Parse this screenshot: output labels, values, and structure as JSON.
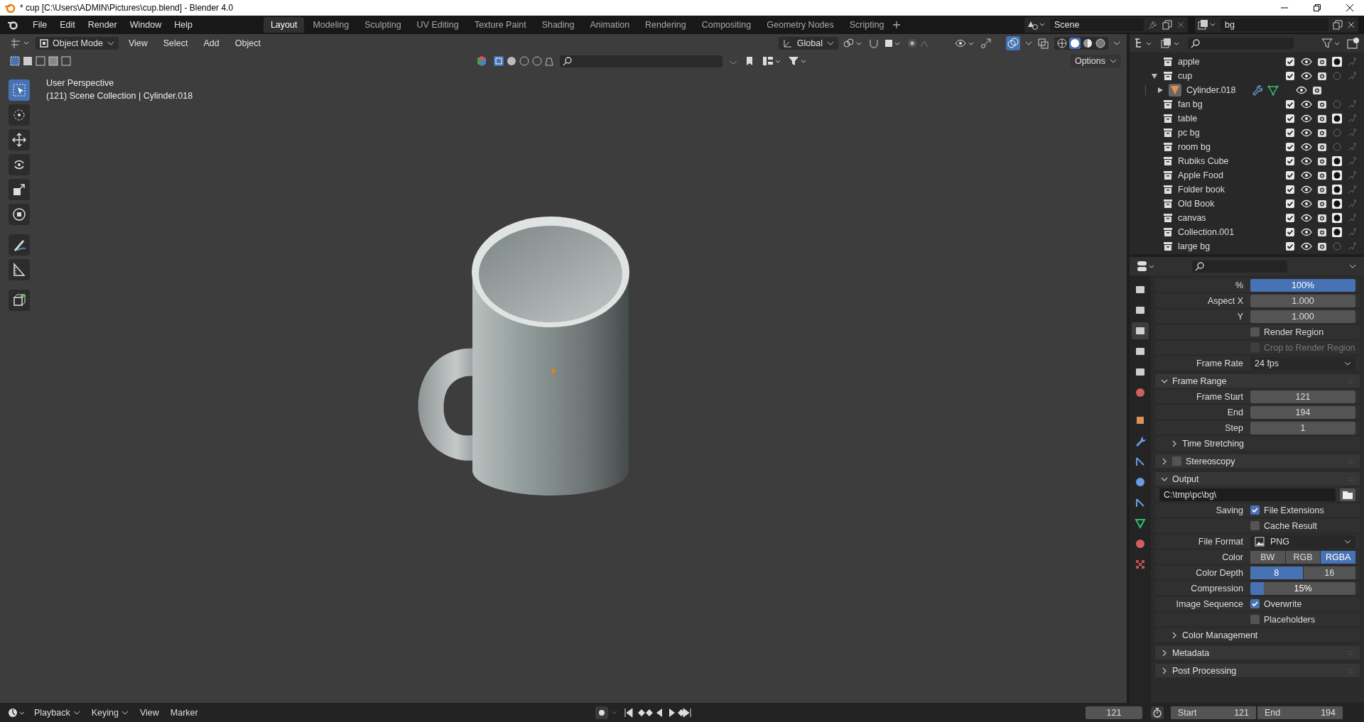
{
  "window": {
    "title": "* cup [C:\\Users\\ADMIN\\Pictures\\cup.blend] - Blender 4.0"
  },
  "menu": [
    "File",
    "Edit",
    "Render",
    "Window",
    "Help"
  ],
  "workspaces": [
    {
      "label": "Layout",
      "selected": true
    },
    {
      "label": "Modeling",
      "selected": false
    },
    {
      "label": "Sculpting",
      "selected": false
    },
    {
      "label": "UV Editing",
      "selected": false
    },
    {
      "label": "Texture Paint",
      "selected": false
    },
    {
      "label": "Shading",
      "selected": false
    },
    {
      "label": "Animation",
      "selected": false
    },
    {
      "label": "Rendering",
      "selected": false
    },
    {
      "label": "Compositing",
      "selected": false
    },
    {
      "label": "Geometry Nodes",
      "selected": false
    },
    {
      "label": "Scripting",
      "selected": false
    }
  ],
  "scene": "Scene",
  "view_layer": "bg",
  "viewport": {
    "mode": "Object Mode",
    "menus": [
      "View",
      "Select",
      "Add",
      "Object"
    ],
    "orientation": "Global",
    "options": "Options",
    "overlay": [
      "User Perspective",
      "(121) Scene Collection | Cylinder.018"
    ],
    "tools": [
      {
        "selected": true
      },
      {
        "selected": false
      },
      {
        "selected": false
      },
      {
        "selected": false
      },
      {
        "selected": false
      },
      {
        "selected": false
      },
      {
        "selected": false
      },
      {
        "selected": false
      },
      {
        "selected": false
      }
    ]
  },
  "outliner": [
    {
      "name": "apple",
      "kind": "collection",
      "checked": true,
      "holdout": true
    },
    {
      "name": "cup",
      "kind": "collection",
      "checked": true,
      "holdout": false,
      "expanded": true,
      "children": [
        {
          "name": "Cylinder.018",
          "kind": "object",
          "expanded": false
        }
      ]
    },
    {
      "name": "fan bg",
      "kind": "collection",
      "checked": true,
      "holdout": false
    },
    {
      "name": "table",
      "kind": "collection",
      "checked": true,
      "holdout": true
    },
    {
      "name": "pc bg",
      "kind": "collection",
      "checked": true,
      "holdout": false
    },
    {
      "name": "room bg",
      "kind": "collection",
      "checked": true,
      "holdout": false
    },
    {
      "name": "Rubiks Cube",
      "kind": "collection",
      "checked": true,
      "holdout": true
    },
    {
      "name": "Apple Food",
      "kind": "collection",
      "checked": true,
      "holdout": true
    },
    {
      "name": "Folder book",
      "kind": "collection",
      "checked": true,
      "holdout": true
    },
    {
      "name": "Old Book",
      "kind": "collection",
      "checked": true,
      "holdout": true
    },
    {
      "name": "canvas",
      "kind": "collection",
      "checked": true,
      "holdout": true
    },
    {
      "name": "Collection.001",
      "kind": "collection",
      "checked": true,
      "holdout": true
    },
    {
      "name": "large  bg",
      "kind": "collection",
      "checked": true,
      "holdout": false
    }
  ],
  "property_tabs": [
    {
      "selected": false
    },
    {
      "selected": false
    },
    {
      "selected": true
    },
    {
      "selected": false
    },
    {
      "selected": false
    },
    {
      "selected": false
    },
    {
      "selected": false
    },
    {
      "selected": false
    },
    {
      "selected": false
    },
    {
      "selected": false
    },
    {
      "selected": false
    },
    {
      "selected": false
    },
    {
      "selected": false
    },
    {
      "selected": false
    }
  ],
  "properties": [
    {
      "kind": "slider",
      "label": "%",
      "value": "100%",
      "level": 1
    },
    {
      "kind": "number",
      "label": "Aspect X",
      "value": "1.000"
    },
    {
      "kind": "number",
      "label": "Y",
      "value": "1.000"
    },
    {
      "kind": "checkbox",
      "text": "Render Region",
      "checked": false,
      "disabled": false
    },
    {
      "kind": "checkbox",
      "text": "Crop to Render Region",
      "checked": false,
      "disabled": true
    },
    {
      "kind": "dropdown",
      "label": "Frame Rate",
      "value": "24 fps"
    },
    {
      "kind": "panel",
      "title": "Frame Range",
      "expanded": true
    },
    {
      "kind": "number",
      "label": "Frame Start",
      "value": "121"
    },
    {
      "kind": "number",
      "label": "End",
      "value": "194"
    },
    {
      "kind": "number",
      "label": "Step",
      "value": "1"
    },
    {
      "kind": "subpanel",
      "title": "Time Stretching",
      "expanded": false
    },
    {
      "kind": "panel",
      "title": "Stereoscopy",
      "expanded": false,
      "checked": false
    },
    {
      "kind": "panel",
      "title": "Output",
      "expanded": true
    },
    {
      "kind": "path",
      "value": "C:\\tmp\\pc\\bg\\"
    },
    {
      "kind": "checkbox",
      "label": "Saving",
      "text": "File Extensions",
      "checked": true,
      "disabled": false
    },
    {
      "kind": "checkbox",
      "text": "Cache Result",
      "checked": false,
      "disabled": false
    },
    {
      "kind": "image-dropdown",
      "label": "File Format",
      "value": "PNG"
    },
    {
      "kind": "segmented",
      "label": "Color",
      "options": [
        {
          "label": "BW",
          "selected": false
        },
        {
          "label": "RGB",
          "selected": false
        },
        {
          "label": "RGBA",
          "selected": true
        }
      ]
    },
    {
      "kind": "segmented",
      "label": "Color Depth",
      "options": [
        {
          "label": "8",
          "selected": true
        },
        {
          "label": "16",
          "selected": false
        }
      ]
    },
    {
      "kind": "slider",
      "label": "Compression",
      "value": "15%",
      "level": 0.13
    },
    {
      "kind": "checkbox",
      "label": "Image Sequence",
      "text": "Overwrite",
      "checked": true,
      "disabled": false
    },
    {
      "kind": "checkbox",
      "text": "Placeholders",
      "checked": false,
      "disabled": false
    },
    {
      "kind": "subpanel",
      "title": "Color Management",
      "expanded": false
    },
    {
      "kind": "panel",
      "title": "Metadata",
      "expanded": false
    },
    {
      "kind": "panel",
      "title": "Post Processing",
      "expanded": false
    }
  ],
  "timeline": {
    "menus": [
      {
        "label": "Playback",
        "dropdown": true
      },
      {
        "label": "Keying",
        "dropdown": true
      },
      {
        "label": "View",
        "dropdown": false
      },
      {
        "label": "Marker",
        "dropdown": false
      }
    ],
    "current_frame": "121",
    "start_label": "Start",
    "start": "121",
    "end_label": "End",
    "end": "194"
  }
}
